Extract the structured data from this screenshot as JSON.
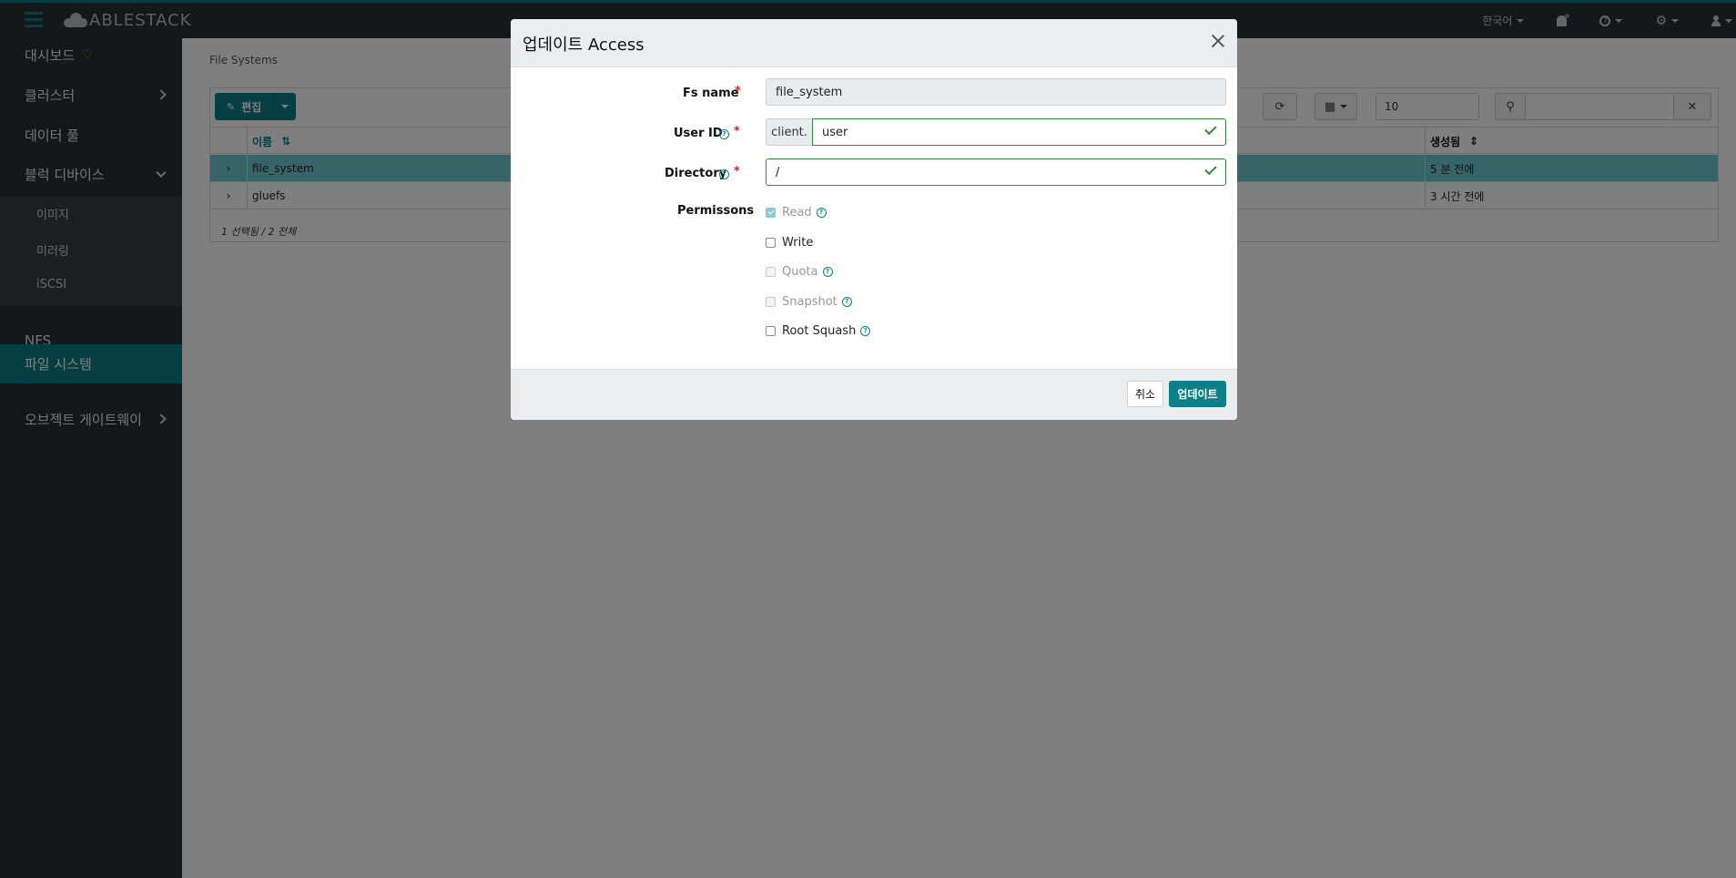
{
  "header": {
    "logo_text": "ABLESTACK",
    "language": "한국어"
  },
  "sidebar": {
    "items": [
      {
        "label": "대시보드"
      },
      {
        "label": "클러스터"
      },
      {
        "label": "데이터 풀"
      },
      {
        "label": "블럭 디바이스"
      },
      {
        "label": "NFS"
      },
      {
        "label": "파일 시스템"
      },
      {
        "label": "오브젝트 게이트웨이"
      }
    ],
    "sub_items": [
      {
        "label": "이미지"
      },
      {
        "label": "미러링"
      },
      {
        "label": "iSCSI"
      }
    ]
  },
  "main": {
    "breadcrumb": "File Systems",
    "toolbar": {
      "edit_label": "편집",
      "page_size": "10",
      "search_value": ""
    },
    "table": {
      "columns": [
        "이름",
        "생성됨"
      ],
      "rows": [
        {
          "name": "file_system",
          "created": "5 분 전에",
          "selected": true
        },
        {
          "name": "gluefs",
          "created": "3 시간 전에",
          "selected": false
        }
      ],
      "footer": "1 선택됨 / 2 전체"
    }
  },
  "modal": {
    "title": "업데이트 Access",
    "fs_name_label": "Fs name",
    "fs_name_value": "file_system",
    "user_id_label": "User ID",
    "user_id_prefix": "client.",
    "user_id_value": "user",
    "directory_label": "Directory",
    "directory_value": "/",
    "permissions_label": "Permissons",
    "permissions": [
      {
        "label": "Read",
        "checked": true,
        "disabled": true
      },
      {
        "label": "Write",
        "checked": false,
        "disabled": false
      },
      {
        "label": "Quota",
        "checked": false,
        "disabled": true
      },
      {
        "label": "Snapshot",
        "checked": false,
        "disabled": true
      },
      {
        "label": "Root Squash",
        "checked": false,
        "disabled": false
      }
    ],
    "cancel_label": "취소",
    "update_label": "업데이트"
  },
  "colors": {
    "accent": "#0c7f87",
    "sidebar_bg": "#2b3035",
    "valid": "#2f8a3a",
    "required": "#d9252a"
  }
}
